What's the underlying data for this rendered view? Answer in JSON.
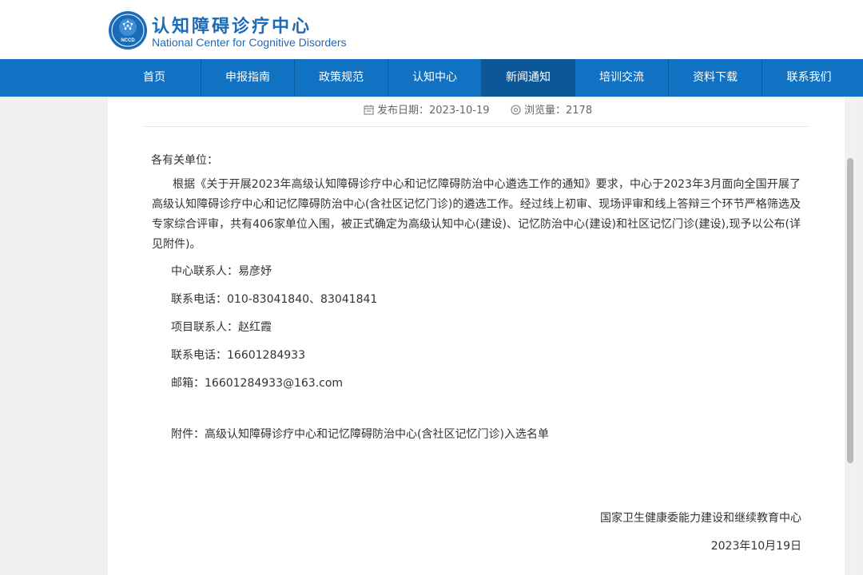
{
  "site": {
    "title_cn": "认知障碍诊疗中心",
    "title_en": "National Center for Cognitive Disorders",
    "logo_text": "NCCD",
    "brand_color": "#1172c4"
  },
  "nav": {
    "items": [
      {
        "label": "首页"
      },
      {
        "label": "申报指南"
      },
      {
        "label": "政策规范"
      },
      {
        "label": "认知中心"
      },
      {
        "label": "新闻通知",
        "active": true
      },
      {
        "label": "培训交流"
      },
      {
        "label": "资料下载"
      },
      {
        "label": "联系我们"
      }
    ]
  },
  "article": {
    "publish_label": "发布日期：",
    "publish_date": "2023-10-19",
    "views_label": "浏览量：",
    "views": "2178",
    "salutation": "各有关单位：",
    "body": "根据《关于开展2023年高级认知障碍诊疗中心和记忆障碍防治中心遴选工作的通知》要求，中心于2023年3月面向全国开展了高级认知障碍诊疗中心和记忆障碍防治中心(含社区记忆门诊)的遴选工作。经过线上初审、现场评审和线上答辩三个环节严格筛选及专家综合评审，共有406家单位入围，被正式确定为高级认知中心(建设)、记忆防治中心(建设)和社区记忆门诊(建设),现予以公布(详见附件)。",
    "contacts": [
      "中心联系人：易彦妤",
      "联系电话：010-83041840、83041841",
      "项目联系人：赵红霞",
      "联系电话：16601284933",
      "邮箱：16601284933@163.com"
    ],
    "attachment_label": "附件：",
    "attachment_link": "高级认知障碍诊疗中心和记忆障碍防治中心(含社区记忆门诊)入选名单",
    "signature_org": "国家卫生健康委能力建设和继续教育中心",
    "signature_date": "2023年10月19日"
  }
}
